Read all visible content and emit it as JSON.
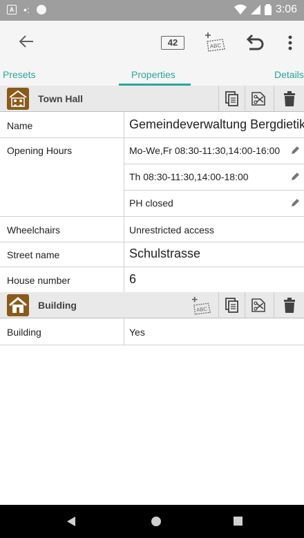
{
  "status_bar": {
    "time": "3:06",
    "left_badge": "A",
    "icons": [
      "wifi-icon",
      "signal-icon",
      "battery-icon"
    ]
  },
  "toolbar": {
    "count_badge": "42",
    "abc_label": "ABC"
  },
  "tabs": [
    {
      "label": "Presets"
    },
    {
      "label": "Properties"
    },
    {
      "label": "Details"
    }
  ],
  "sections": [
    {
      "title": "Town Hall",
      "rows": [
        {
          "key": "Name",
          "values": [
            "Gemeindeverwaltung Bergdietikon"
          ]
        },
        {
          "key": "Opening Hours",
          "values": [
            "Mo-We,Fr 08:30-11:30,14:00-16:00",
            "Th 08:30-11:30,14:00-18:00",
            "PH closed"
          ]
        },
        {
          "key": "Wheelchairs",
          "values": [
            "Unrestricted access"
          ]
        },
        {
          "key": "Street name",
          "values": [
            "Schulstrasse"
          ]
        },
        {
          "key": "House number",
          "values": [
            "6"
          ]
        }
      ]
    },
    {
      "title": "Building",
      "abc_label": "ABC",
      "rows": [
        {
          "key": "Building",
          "values": [
            "Yes"
          ]
        }
      ]
    }
  ],
  "colors": {
    "accent": "#26a69a",
    "preset_icon_bg": "#8b5a1a",
    "status_bar": "#9e9e9e",
    "header_bg": "#e9e9e9"
  }
}
